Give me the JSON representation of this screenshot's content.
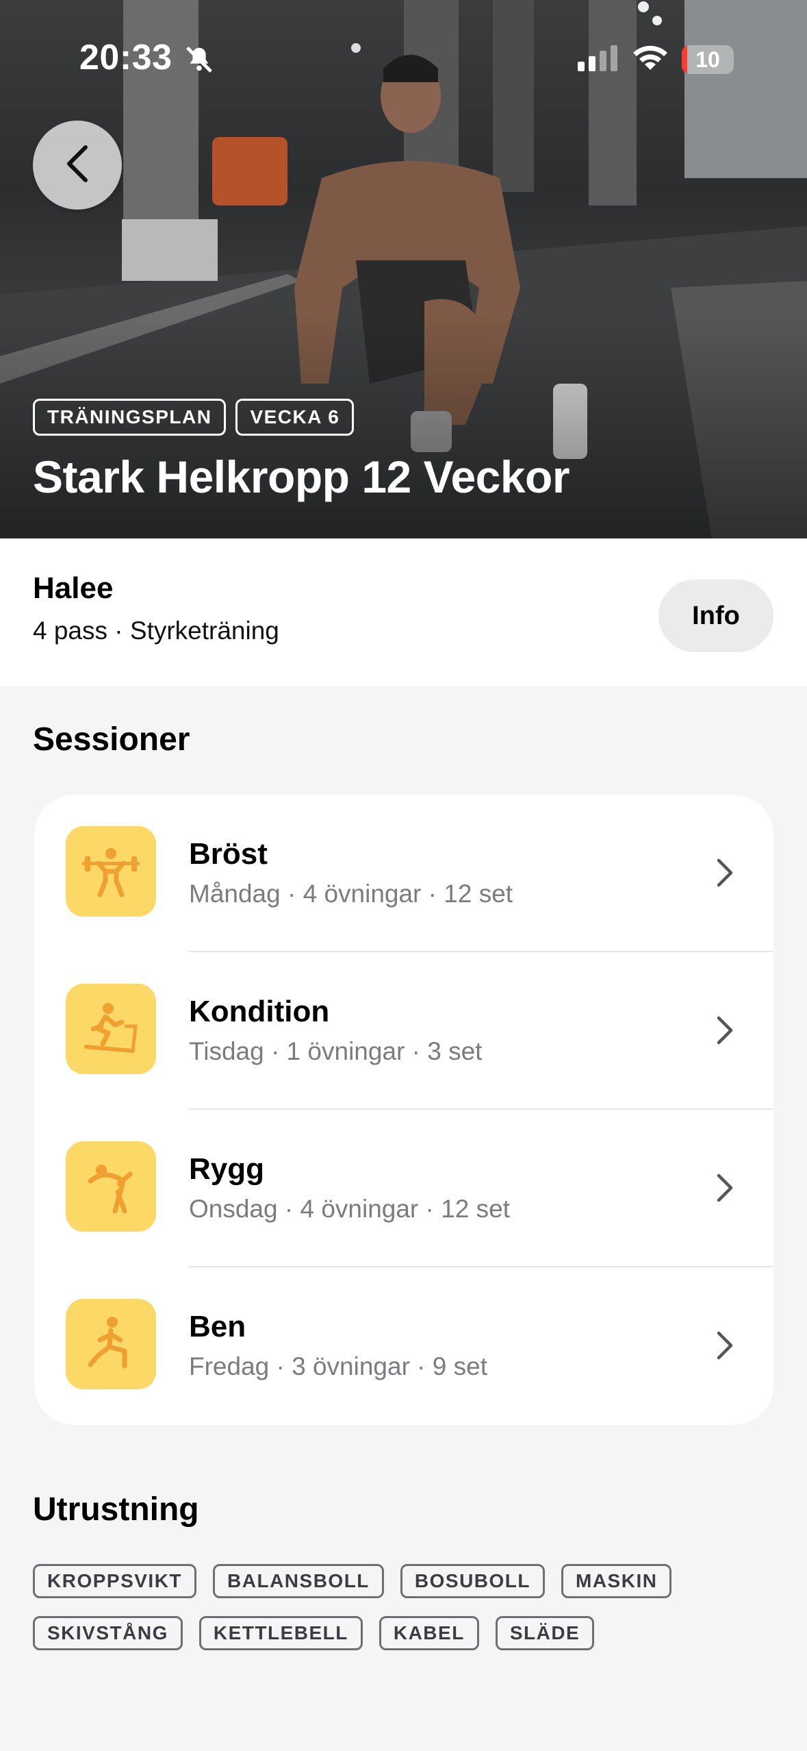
{
  "status_bar": {
    "time": "20:33",
    "battery": "10",
    "battery_level": 0.1
  },
  "hero": {
    "tags": [
      "TRÄNINGSPLAN",
      "VECKA 6"
    ],
    "title": "Stark Helkropp 12 Veckor"
  },
  "author": {
    "name": "Halee",
    "meta": "4 pass · Styrketräning",
    "info_label": "Info"
  },
  "sessions": {
    "heading": "Sessioner",
    "items": [
      {
        "title": "Bröst",
        "subtitle": "Måndag · 4 övningar · 12 set",
        "icon": "weightlifting-icon"
      },
      {
        "title": "Kondition",
        "subtitle": "Tisdag · 1 övningar · 3 set",
        "icon": "treadmill-icon"
      },
      {
        "title": "Rygg",
        "subtitle": "Onsdag · 4 övningar · 12 set",
        "icon": "stretching-icon"
      },
      {
        "title": "Ben",
        "subtitle": "Fredag · 3 övningar · 9 set",
        "icon": "lunge-icon"
      }
    ]
  },
  "equipment": {
    "heading": "Utrustning",
    "tags": [
      "KROPPSVIKT",
      "BALANSBOLL",
      "BOSUBOLL",
      "MASKIN",
      "SKIVSTÅNG",
      "KETTLEBELL",
      "KABEL",
      "SLÄDE"
    ]
  },
  "colors": {
    "accent_icon_bg": "#fcd867",
    "icon_fg": "#f0a030",
    "page_bg": "#f5f5f5"
  }
}
